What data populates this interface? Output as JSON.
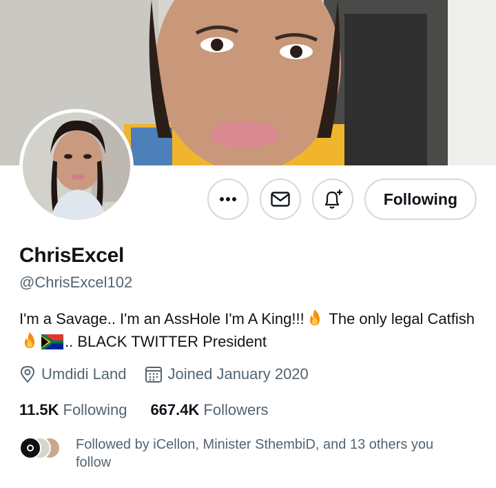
{
  "profile": {
    "display_name": "ChrisExcel",
    "handle": "@ChrisExcel102",
    "bio_part1": "I'm a Savage.. I'm an AssHole I'm A King!!!",
    "bio_part2": " The only legal Catfish ",
    "bio_part3": ".. BLACK TWITTER President",
    "location": "Umdidi Land",
    "joined": "Joined January 2020",
    "following_count": "11.5K",
    "following_label": "Following",
    "followers_count": "667.4K",
    "followers_label": "Followers",
    "followed_by": "Followed by iCellon, Minister SthembiD, and 13 others you follow"
  },
  "actions": {
    "follow_button_label": "Following"
  },
  "icons": [
    "more-icon",
    "mail-icon",
    "bell-plus-icon",
    "location-pin-icon",
    "calendar-icon",
    "fire-emoji",
    "south-africa-flag-emoji"
  ],
  "colors": {
    "text_primary": "#0f1419",
    "text_secondary": "#536471",
    "border": "#cfd9de"
  }
}
